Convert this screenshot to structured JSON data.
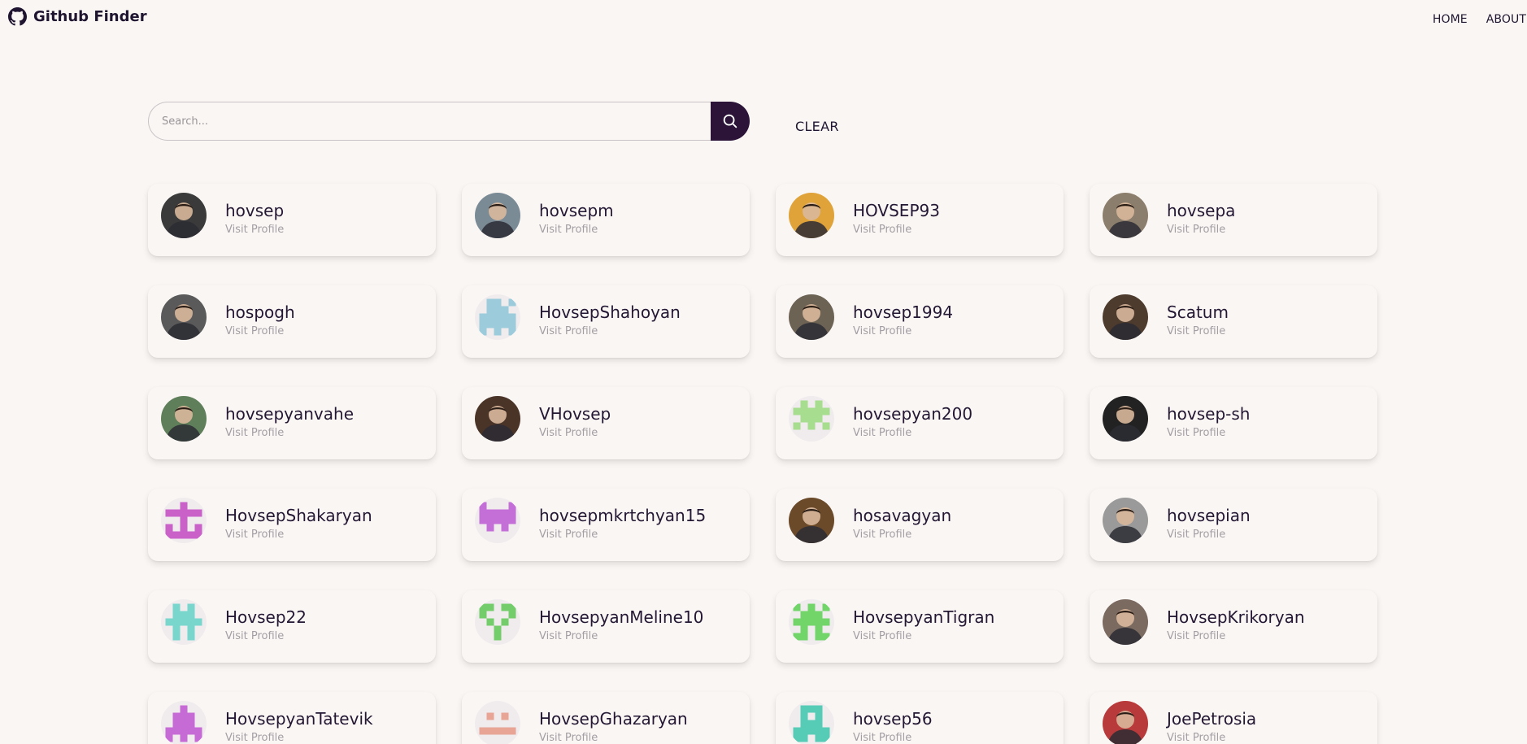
{
  "brand": {
    "title": "Github Finder",
    "icon": "github-icon"
  },
  "nav": {
    "items": [
      "HOME",
      "ABOUT"
    ]
  },
  "search": {
    "placeholder": "Search...",
    "value": "",
    "clear_label": "CLEAR"
  },
  "colors": {
    "background": "#faf6f4",
    "accent": "#2b1438",
    "muted": "#a39ea3"
  },
  "users": [
    {
      "login": "hovsep",
      "link": "Visit Profile",
      "avatar": "photo",
      "color": "#3a3a3a"
    },
    {
      "login": "hovsepm",
      "link": "Visit Profile",
      "avatar": "photo",
      "color": "#7a8b96"
    },
    {
      "login": "HOVSEP93",
      "link": "Visit Profile",
      "avatar": "photo",
      "color": "#e0a33a"
    },
    {
      "login": "hovsepa",
      "link": "Visit Profile",
      "avatar": "photo",
      "color": "#8c7e6c"
    },
    {
      "login": "hospogh",
      "link": "Visit Profile",
      "avatar": "photo",
      "color": "#5a5a5a"
    },
    {
      "login": "HovsepShahoyan",
      "link": "Visit Profile",
      "avatar": "identicon",
      "color": "#9ccbdc",
      "pattern": "0110101110111111111110101"
    },
    {
      "login": "hovsep1994",
      "link": "Visit Profile",
      "avatar": "photo",
      "color": "#6d6355"
    },
    {
      "login": "Scatum",
      "link": "Visit Profile",
      "avatar": "photo",
      "color": "#4d3b2d"
    },
    {
      "login": "hovsepyanvahe",
      "link": "Visit Profile",
      "avatar": "photo",
      "color": "#5f7f5a"
    },
    {
      "login": "VHovsep",
      "link": "Visit Profile",
      "avatar": "photo",
      "color": "#4a3428"
    },
    {
      "login": "hovsepyan200",
      "link": "Visit Profile",
      "avatar": "identicon",
      "color": "#a6dd8f",
      "pattern": "0101011111011101010100000"
    },
    {
      "login": "hovsep-sh",
      "link": "Visit Profile",
      "avatar": "photo",
      "color": "#222222"
    },
    {
      "login": "HovsepShakaryan",
      "link": "Visit Profile",
      "avatar": "identicon",
      "color": "#c961c9",
      "pattern": "0010011111001001010111111"
    },
    {
      "login": "hovsepmkrtchyan15",
      "link": "Visit Profile",
      "avatar": "identicon",
      "color": "#c46fd8",
      "pattern": "1000111111111110101000000"
    },
    {
      "login": "hosavagyan",
      "link": "Visit Profile",
      "avatar": "photo",
      "color": "#6b4a2a"
    },
    {
      "login": "hovsepian",
      "link": "Visit Profile",
      "avatar": "photo",
      "color": "#9a9a9a"
    },
    {
      "login": "Hovsep22",
      "link": "Visit Profile",
      "avatar": "identicon",
      "color": "#78d6cc",
      "pattern": "0101001110111110101001010"
    },
    {
      "login": "HovsepyanMeline10",
      "link": "Visit Profile",
      "avatar": "identicon",
      "color": "#74cd6b",
      "pattern": "1101110001010100010000100"
    },
    {
      "login": "HovsepyanTigran",
      "link": "Visit Profile",
      "avatar": "identicon",
      "color": "#72d56a",
      "pattern": "1010101110111110101011011"
    },
    {
      "login": "HovsepKrikoryan",
      "link": "Visit Profile",
      "avatar": "photo",
      "color": "#7a6a60"
    },
    {
      "login": "HovsepyanTatevik",
      "link": "Visit Profile",
      "avatar": "identicon",
      "color": "#c66ad6",
      "pattern": "0010001110011101111110101"
    },
    {
      "login": "HovsepGhazaryan",
      "link": "Visit Profile",
      "avatar": "identicon",
      "color": "#e8a596",
      "pattern": "0000001010000001111100000"
    },
    {
      "login": "hovsep56",
      "link": "Visit Profile",
      "avatar": "identicon",
      "color": "#56cbb6",
      "pattern": "0111001010011101111111011"
    },
    {
      "login": "JoePetrosia",
      "link": "Visit Profile",
      "avatar": "photo",
      "color": "#b83a3a"
    }
  ]
}
